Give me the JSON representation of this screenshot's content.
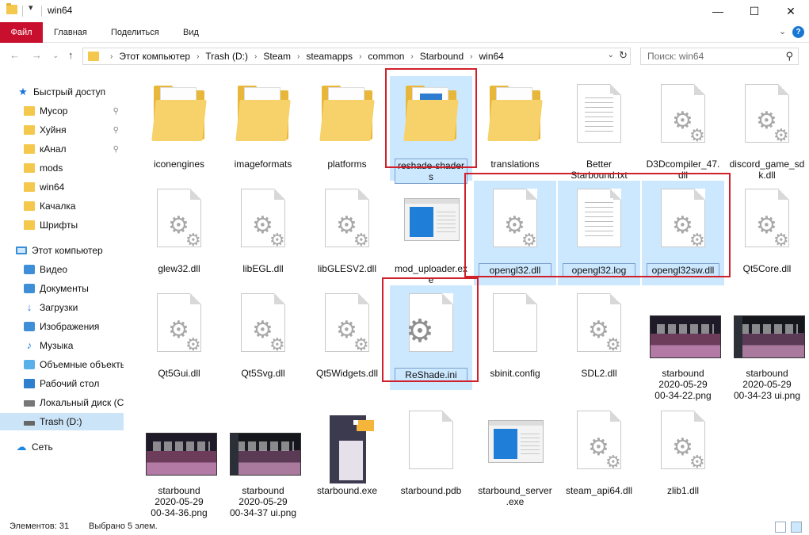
{
  "window": {
    "title": "win64",
    "quick_access_arrow": "▾",
    "minimize": "—",
    "maximize": "☐",
    "close": "✕"
  },
  "ribbon": {
    "tabs": [
      "Файл",
      "Главная",
      "Поделиться",
      "Вид"
    ],
    "expand": "⌄",
    "help": "?"
  },
  "nav": {
    "back": "←",
    "forward": "→",
    "recent": "⌄",
    "up": "↑",
    "breadcrumbs": [
      "Этот компьютер",
      "Trash (D:)",
      "Steam",
      "steamapps",
      "common",
      "Starbound",
      "win64"
    ],
    "crumb_separator": "›",
    "dropdown": "⌄",
    "refresh": "↻",
    "search_placeholder": "Поиск: win64",
    "search_icon": "⚲"
  },
  "sidebar": {
    "items": [
      {
        "label": "Быстрый доступ",
        "icon": "star-icon",
        "pinned": false
      },
      {
        "label": "Мусор",
        "icon": "folder-icon",
        "pinned": true
      },
      {
        "label": "Хуйня",
        "icon": "folder-icon",
        "pinned": true
      },
      {
        "label": "кАнал",
        "icon": "folder-icon",
        "pinned": true
      },
      {
        "label": "mods",
        "icon": "folder-icon",
        "pinned": false
      },
      {
        "label": "win64",
        "icon": "folder-icon",
        "pinned": false
      },
      {
        "label": "Качалка",
        "icon": "folder-icon",
        "pinned": false
      },
      {
        "label": "Шрифты",
        "icon": "folder-icon",
        "pinned": false
      },
      {
        "label": "Этот компьютер",
        "icon": "computer-icon",
        "pinned": false
      },
      {
        "label": "Видео",
        "icon": "video-icon",
        "pinned": false
      },
      {
        "label": "Документы",
        "icon": "documents-icon",
        "pinned": false
      },
      {
        "label": "Загрузки",
        "icon": "download-icon",
        "pinned": false
      },
      {
        "label": "Изображения",
        "icon": "pictures-icon",
        "pinned": false
      },
      {
        "label": "Музыка",
        "icon": "music-icon",
        "pinned": false
      },
      {
        "label": "Объемные объекты",
        "icon": "3d-objects-icon",
        "pinned": false
      },
      {
        "label": "Рабочий стол",
        "icon": "desktop-icon",
        "pinned": false
      },
      {
        "label": "Локальный диск (C",
        "icon": "local-disk-icon",
        "pinned": false
      },
      {
        "label": "Trash (D:)",
        "icon": "drive-icon",
        "pinned": false
      },
      {
        "label": "Сеть",
        "icon": "network-icon",
        "pinned": false
      }
    ],
    "pin_glyph": "📌"
  },
  "files": [
    {
      "name": "iconengines",
      "kind": "folder-gear"
    },
    {
      "name": "imageformats",
      "kind": "folder-gear"
    },
    {
      "name": "platforms",
      "kind": "folder-gear"
    },
    {
      "name": "reshade-shaders",
      "kind": "folder-blue",
      "selected": true
    },
    {
      "name": "translations",
      "kind": "folder"
    },
    {
      "name": "Better Starbound.txt",
      "kind": "text"
    },
    {
      "name": "D3Dcompiler_47.dll",
      "kind": "dll"
    },
    {
      "name": "discord_game_sdk.dll",
      "kind": "dll"
    },
    {
      "name": "glew32.dll",
      "kind": "dll"
    },
    {
      "name": "libEGL.dll",
      "kind": "dll"
    },
    {
      "name": "libGLESV2.dll",
      "kind": "dll"
    },
    {
      "name": "mod_uploader.exe",
      "kind": "app"
    },
    {
      "name": "opengl32.dll",
      "kind": "dll",
      "selected": true
    },
    {
      "name": "opengl32.log",
      "kind": "text",
      "selected": true
    },
    {
      "name": "opengl32sw.dll",
      "kind": "dll",
      "selected": true
    },
    {
      "name": "Qt5Core.dll",
      "kind": "dll"
    },
    {
      "name": "Qt5Gui.dll",
      "kind": "dll"
    },
    {
      "name": "Qt5Svg.dll",
      "kind": "dll"
    },
    {
      "name": "Qt5Widgets.dll",
      "kind": "dll"
    },
    {
      "name": "ReShade.ini",
      "kind": "ini",
      "selected": true
    },
    {
      "name": "sbinit.config",
      "kind": "blank"
    },
    {
      "name": "SDL2.dll",
      "kind": "dll"
    },
    {
      "name": "starbound 2020-05-29 00-34-22.png",
      "kind": "screenshot"
    },
    {
      "name": "starbound 2020-05-29 00-34-23 ui.png",
      "kind": "screenshot-ui"
    },
    {
      "name": "starbound 2020-05-29 00-34-36.png",
      "kind": "screenshot"
    },
    {
      "name": "starbound 2020-05-29 00-34-37 ui.png",
      "kind": "screenshot-ui"
    },
    {
      "name": "starbound.exe",
      "kind": "penguin"
    },
    {
      "name": "starbound.pdb",
      "kind": "blank"
    },
    {
      "name": "starbound_server.exe",
      "kind": "app"
    },
    {
      "name": "steam_api64.dll",
      "kind": "dll"
    },
    {
      "name": "zlib1.dll",
      "kind": "dll"
    }
  ],
  "file_labels": [
    [
      "iconengines"
    ],
    [
      "imageformats"
    ],
    [
      "platforms"
    ],
    [
      "reshade-shaders"
    ],
    [
      "translations"
    ],
    [
      "Better",
      "Starbound.txt"
    ],
    [
      "D3Dcompiler_47.",
      "dll"
    ],
    [
      "discord_game_sd",
      "k.dll"
    ],
    [
      "glew32.dll"
    ],
    [
      "libEGL.dll"
    ],
    [
      "libGLESV2.dll"
    ],
    [
      "mod_uploader.ex",
      "e"
    ],
    [
      "opengl32.dll"
    ],
    [
      "opengl32.log"
    ],
    [
      "opengl32sw.dll"
    ],
    [
      "Qt5Core.dll"
    ],
    [
      "Qt5Gui.dll"
    ],
    [
      "Qt5Svg.dll"
    ],
    [
      "Qt5Widgets.dll"
    ],
    [
      "ReShade.ini"
    ],
    [
      "sbinit.config"
    ],
    [
      "SDL2.dll"
    ],
    [
      "starbound",
      "2020-05-29",
      "00-34-22.png"
    ],
    [
      "starbound",
      "2020-05-29",
      "00-34-23 ui.png"
    ],
    [
      "starbound",
      "2020-05-29",
      "00-34-36.png"
    ],
    [
      "starbound",
      "2020-05-29",
      "00-34-37 ui.png"
    ],
    [
      "starbound.exe"
    ],
    [
      "starbound.pdb"
    ],
    [
      "starbound_server",
      ".exe"
    ],
    [
      "steam_api64.dll"
    ],
    [
      "zlib1.dll"
    ]
  ],
  "status": {
    "items_count": "Элементов: 31",
    "selected_count": "Выбрано 5 элем."
  },
  "colors": {
    "file_tab": "#c8102e",
    "selection": "#cce8ff",
    "highlight_box": "#d0202a",
    "sidebar_selected": "#cce4f7"
  }
}
